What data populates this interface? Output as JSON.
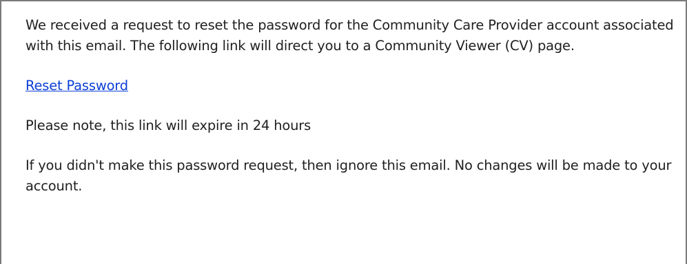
{
  "email": {
    "intro": "We received a request to reset the password for the Community Care Provider account associated with this email. The following link will direct you to a Community Viewer (CV) page.",
    "reset_link_label": "Reset Password",
    "expiry_note": "Please note, this link will expire in 24 hours",
    "ignore_note": "If you didn't make this password request, then ignore this email. No changes will be made to your account."
  },
  "colors": {
    "link": "#0b3fd6",
    "text": "#1f1f1f",
    "border": "#7a7a7a"
  }
}
